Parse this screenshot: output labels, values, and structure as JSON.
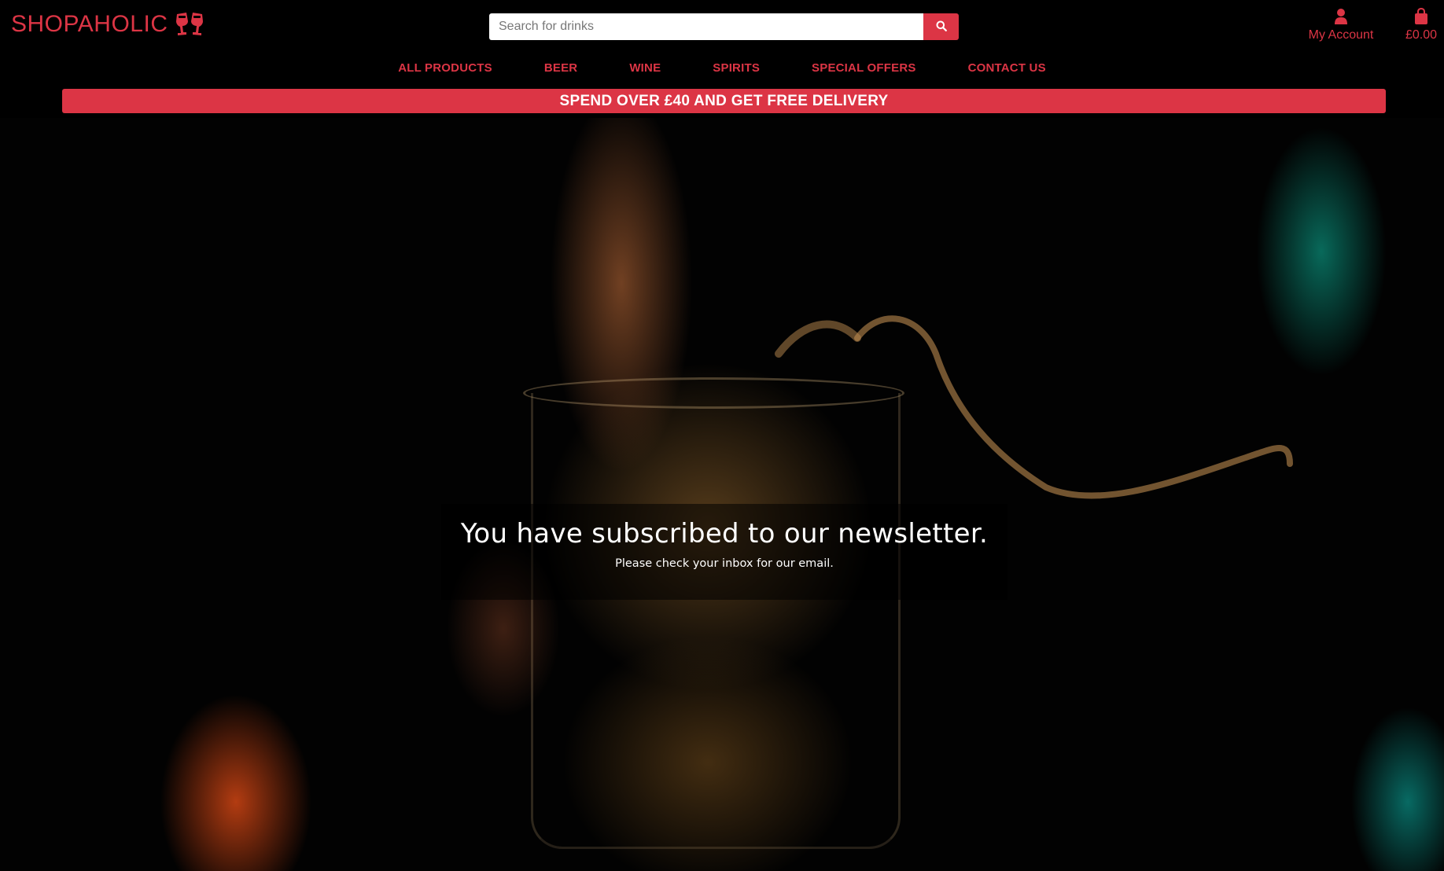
{
  "brand": {
    "name": "SHOPAHOLIC",
    "icon": "cheers-glasses-icon",
    "accent_color": "#dc3545"
  },
  "search": {
    "placeholder": "Search for drinks",
    "button_icon": "search-icon"
  },
  "account": {
    "label": "My Account",
    "icon": "user-icon"
  },
  "cart": {
    "total": "£0.00",
    "icon": "shopping-bag-icon"
  },
  "nav": {
    "items": [
      {
        "label": "ALL PRODUCTS"
      },
      {
        "label": "BEER"
      },
      {
        "label": "WINE"
      },
      {
        "label": "SPIRITS"
      },
      {
        "label": "SPECIAL OFFERS"
      },
      {
        "label": "CONTACT US"
      }
    ]
  },
  "banner": {
    "text": "SPEND OVER £40 AND GET FREE DELIVERY"
  },
  "message": {
    "title": "You have subscribed to our newsletter.",
    "subtitle": "Please check your inbox for our email."
  }
}
